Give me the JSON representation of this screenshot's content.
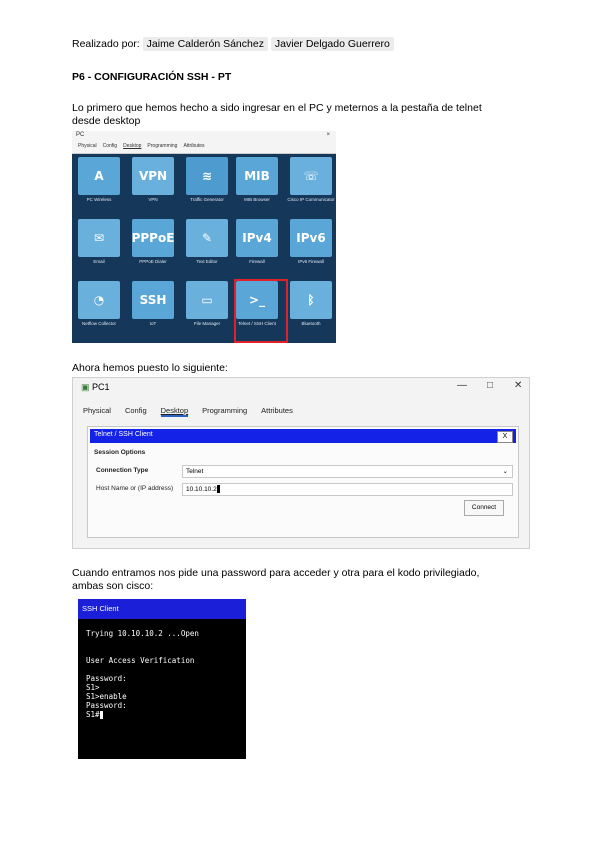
{
  "header": {
    "realizado_label": "Realizado por:",
    "authors": [
      "Jaime Calderón Sánchez",
      "Javier Delgado Guerrero"
    ]
  },
  "doc_title": "P6 - CONFIGURACIÓN SSH - PT",
  "para1_line1": "Lo primero que hemos hecho a sido ingresar en el PC y meternos a la pestaña de telnet",
  "para1_line2": "desde desktop",
  "shot1": {
    "window_title": "PC",
    "close_glyph": "×",
    "tabs": [
      "Physical",
      "Config",
      "Desktop",
      "Programming",
      "Attributes"
    ],
    "apps": [
      {
        "label": "PC Wireless",
        "color": "#5aa6d6"
      },
      {
        "label": "VPN",
        "color": "#6ab0dc"
      },
      {
        "label": "Traffic Generator",
        "color": "#4e9ccf"
      },
      {
        "label": "MIB Browser",
        "color": "#5aa6d6"
      },
      {
        "label": "Cisco IP Communicator",
        "color": "#6ab0dc"
      },
      {
        "label": "Email",
        "color": "#6ab0dc"
      },
      {
        "label": "PPPoE Dialer",
        "color": "#5aa6d6"
      },
      {
        "label": "Text Editor",
        "color": "#6ab0dc"
      },
      {
        "label": "Firewall",
        "color": "#5aa6d6"
      },
      {
        "label": "IPv6 Firewall",
        "color": "#5aa6d6"
      },
      {
        "label": "Netflow Collector",
        "color": "#6ab0dc"
      },
      {
        "label": "IoT",
        "color": "#5aa6d6"
      },
      {
        "label": "File Manager",
        "color": "#6ab0dc"
      },
      {
        "label": "Telnet / SSH Client",
        "color": "#5aa6d6"
      },
      {
        "label": "Bluetooth",
        "color": "#6ab0dc"
      }
    ],
    "icon_glyphs": [
      "A",
      "VPN",
      "≋",
      "MIB",
      "☏",
      "✉",
      "PPPoE",
      "✎",
      "IPv4",
      "IPv6",
      "◔",
      "SSH",
      "▭",
      ">_",
      "ᛒ"
    ]
  },
  "para2": "Ahora hemos puesto lo siguiente:",
  "shot2": {
    "window_title": "PC1",
    "minimize": "—",
    "maximize": "□",
    "close": "✕",
    "tabs": [
      "Physical",
      "Config",
      "Desktop",
      "Programming",
      "Attributes"
    ],
    "panel_title": "Telnet / SSH Client",
    "panel_close": "X",
    "session_options": "Session Options",
    "connection_type_label": "Connection Type",
    "connection_type_value": "Telnet",
    "dropdown_glyph": "⌄",
    "host_label": "Host Name or (IP address)",
    "host_value": "10.10.10.2",
    "connect_label": "Connect"
  },
  "para3_line1": "Cuando entramos nos pide una password para acceder y otra para el kodo privilegiado,",
  "para3_line2": "ambas son cisco:",
  "shot3": {
    "title": "SSH Client",
    "lines": [
      "Trying 10.10.10.2 ...Open",
      "",
      "",
      "User Access Verification",
      "",
      "Password:",
      "S1>",
      "S1>enable",
      "Password:",
      "S1#"
    ]
  }
}
